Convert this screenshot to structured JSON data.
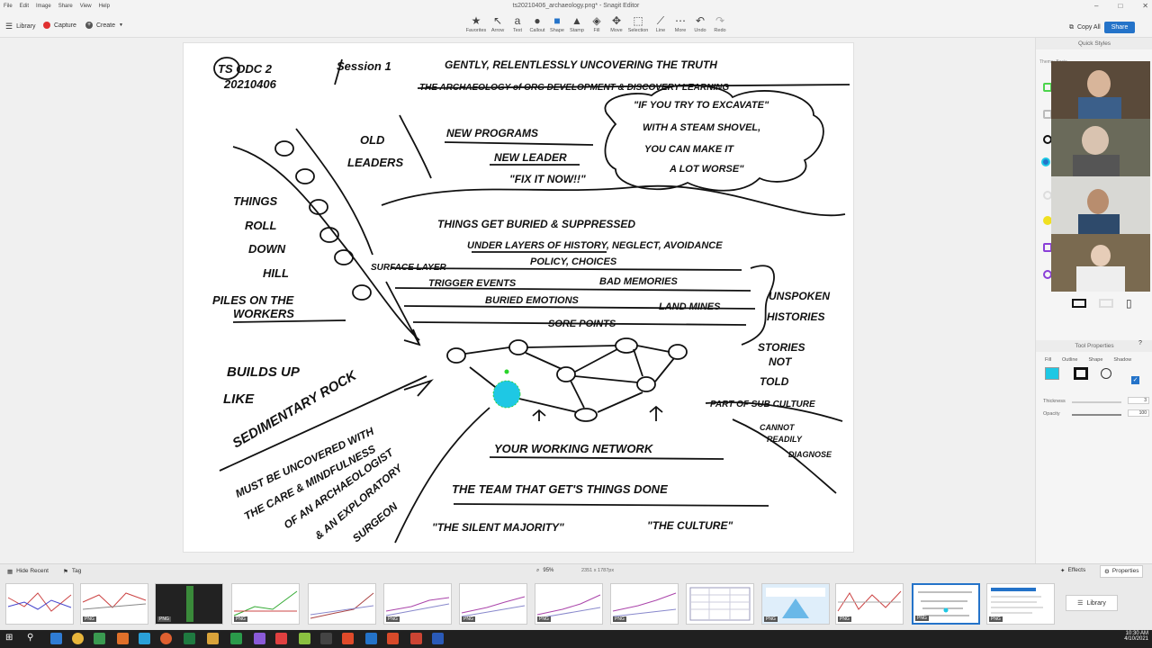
{
  "window": {
    "title": "ts20210406_archaeology.png* - Snagit Editor",
    "menus": [
      "File",
      "Edit",
      "Image",
      "Share",
      "View",
      "Help"
    ]
  },
  "toolbar": {
    "library": "Library",
    "capture": "Capture",
    "create": "Create",
    "tools": [
      "Favorites",
      "Arrow",
      "Text",
      "Callout",
      "Shape",
      "Stamp",
      "Fill",
      "Move",
      "Selection",
      "Line",
      "More",
      "Undo",
      "Redo"
    ],
    "copy_all": "Copy All",
    "share": "Share"
  },
  "sidebar": {
    "quick_styles": "Quick Styles",
    "theme": "Theme: Basic",
    "tool_properties": "Tool Properties",
    "props": [
      "Fill",
      "Outline",
      "Shape",
      "Shadow"
    ],
    "thickness_label": "Thickness",
    "thickness_value": "3",
    "opacity_label": "Opacity",
    "opacity_value": "100"
  },
  "bottom_bar": {
    "hide_recent": "Hide Recent",
    "tag": "Tag",
    "zoom": "95%",
    "dimensions": "2351 x 1787px",
    "effects": "Effects",
    "properties": "Properties",
    "library": "Library",
    "png": "PNG"
  },
  "taskbar": {
    "time": "10:30 AM",
    "date": "4/10/2021"
  },
  "sketch": {
    "header": [
      "TS ODC 2",
      "20210406",
      "Session 1",
      "GENTLY, RELENTLESSLY  UNCOVERING THE TRUTH",
      "THE ARCHAEOLOGY of ORG DEVELOPMENT & DISCOVERY LEARNING"
    ],
    "quote": [
      "\"IF YOU TRY TO EXCAVATE\"",
      "WITH A STEAM SHOVEL,",
      "YOU CAN MAKE IT",
      "A LOT WORSE\""
    ],
    "top_notes": [
      "OLD",
      "LEADERS",
      "NEW PROGRAMS",
      "NEW LEADER",
      "\"FIX IT NOW!!\""
    ],
    "left": [
      "THINGS",
      "ROLL",
      "DOWN",
      "HILL",
      "PILES ON THE",
      "WORKERS",
      "BUILDS UP",
      "LIKE",
      "SEDIMENTARY ROCK",
      "MUST BE UNCOVERED WITH",
      "THE CARE & MINDFULNESS",
      "OF AN ARCHAEOLOGIST",
      "& AN EXPLORATORY",
      "SURGEON"
    ],
    "middle": [
      "THINGS GET BURIED & SUPPRESSED",
      "UNDER LAYERS OF HISTORY, NEGLECT, AVOIDANCE",
      "POLICY, CHOICES",
      "SURFACE LAYER",
      "TRIGGER EVENTS",
      "BAD MEMORIES",
      "BURIED EMOTIONS",
      "LAND MINES",
      "SORE POINTS"
    ],
    "right": [
      "UNSPOKEN",
      "HISTORIES",
      "STORIES",
      "NOT",
      "TOLD",
      "PART OF SUB CULTURE",
      "CANNOT",
      "READILY",
      "DIAGNOSE"
    ],
    "bottom": [
      "YOUR WORKING NETWORK",
      "THE TEAM THAT GET'S THINGS DONE",
      "\"THE SILENT MAJORITY\"",
      "\"THE CULTURE\""
    ]
  },
  "colors": {
    "accent": "#2473c9",
    "node": "#1ec8e4",
    "sel": "#2ad42a"
  }
}
